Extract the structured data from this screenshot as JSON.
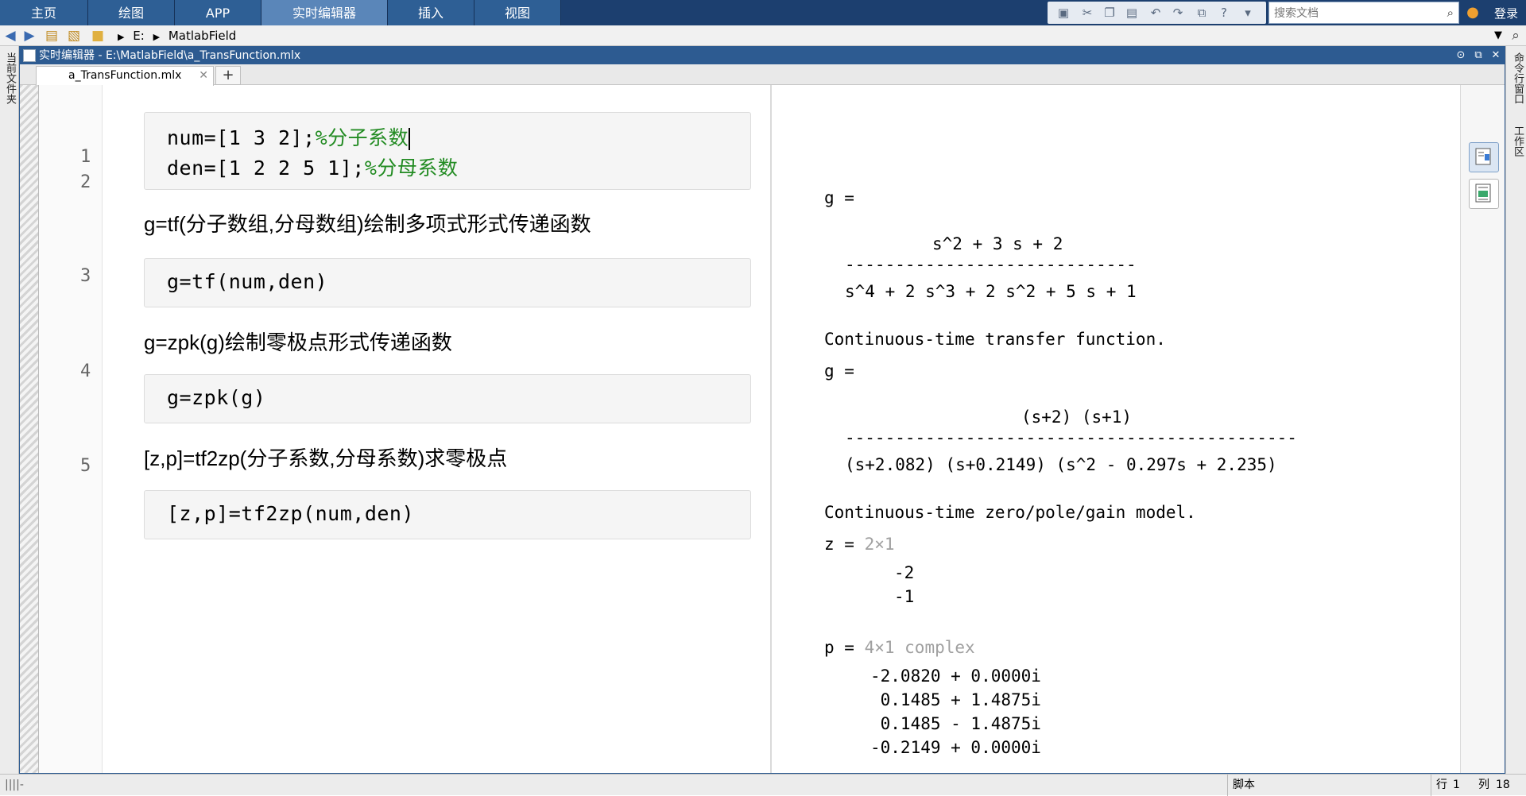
{
  "ribbon": {
    "tabs": [
      "主页",
      "绘图",
      "APP",
      "实时编辑器",
      "插入",
      "视图"
    ],
    "active_tab": "实时编辑器",
    "search_placeholder": "搜索文档",
    "login_label": "登录"
  },
  "address": {
    "path": [
      "E:",
      "MatlabField"
    ]
  },
  "side_panels": {
    "left_label": "当前文件夹",
    "right_labels": [
      "命令行窗口",
      "工作区"
    ]
  },
  "editor": {
    "title": "实时编辑器 - E:\\MatlabField\\a_TransFunction.mlx",
    "file_tab": "a_TransFunction.mlx",
    "add_tab_label": "+",
    "line_numbers": [
      "1",
      "2",
      "3",
      "4",
      "5"
    ],
    "code": {
      "line1_code": "num=[1 3 2];",
      "line1_comment": "%分子系数",
      "line2_code": "den=[1 2 2 5 1];",
      "line2_comment": "%分母系数",
      "line3": "g=tf(num,den)",
      "line4": "g=zpk(g)",
      "line5": "[z,p]=tf2zp(num,den)"
    },
    "text": {
      "t1": "g=tf(分子数组,分母数组)绘制多项式形式传递函数",
      "t2": "g=zpk(g)绘制零极点形式传递函数",
      "t3": "[z,p]=tf2zp(分子系数,分母系数)求零极点"
    }
  },
  "output": {
    "g1_label": "g =",
    "g1_num": "s^2 + 3 s + 2",
    "g1_bar": "-----------------------------",
    "g1_den": "s^4 + 2 s^3 + 2 s^2 + 5 s + 1",
    "g1_desc": "Continuous-time transfer function.",
    "g2_label": "g =",
    "g2_num": "(s+2) (s+1)",
    "g2_bar": "---------------------------------------------",
    "g2_den": "(s+2.082) (s+0.2149) (s^2 - 0.297s + 2.235)",
    "g2_desc": "Continuous-time zero/pole/gain model.",
    "z_label": "z =",
    "z_dim": "2×1",
    "z_values": [
      "-2",
      "-1"
    ],
    "p_label": "p =",
    "p_dim": "4×1 complex",
    "p_values": [
      "-2.0820 + 0.0000i",
      " 0.1485 + 1.4875i",
      " 0.1485 - 1.4875i",
      "-0.2149 + 0.0000i"
    ]
  },
  "status": {
    "mode": "脚本",
    "row_label": "行",
    "row_value": "1",
    "col_label": "列",
    "col_value": "18"
  }
}
